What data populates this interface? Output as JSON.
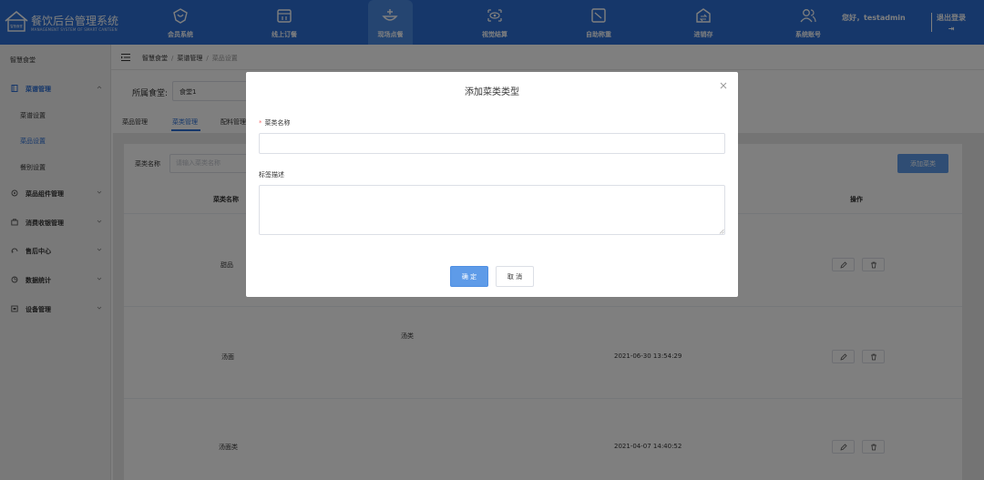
{
  "header": {
    "logo_text": "智慧食堂",
    "app_title": "餐饮后台管理系统",
    "app_subtitle": "MANAGEMENT SYSTEM OF SMART CANTEEN",
    "nav": [
      {
        "label": "会员系统",
        "icon": "heart-shield-icon"
      },
      {
        "label": "线上订餐",
        "icon": "storefront-icon"
      },
      {
        "label": "现场点餐",
        "icon": "dish-icon",
        "active": true
      },
      {
        "label": "视觉结算",
        "icon": "eye-icon"
      },
      {
        "label": "自助称重",
        "icon": "scale-icon"
      },
      {
        "label": "进销存",
        "icon": "inventory-icon"
      },
      {
        "label": "系统账号",
        "icon": "users-icon"
      }
    ],
    "greeting": "您好，testadmin",
    "logout": "退出登录"
  },
  "sidebar": {
    "root": "智慧食堂",
    "groups": [
      {
        "label": "菜谱管理",
        "icon": "book-icon",
        "open": true,
        "items": [
          "菜谱设置",
          "菜品设置",
          "餐别设置"
        ],
        "active_item": "菜品设置"
      },
      {
        "label": "菜品组件管理",
        "icon": "component-icon"
      },
      {
        "label": "消费收银管理",
        "icon": "cashier-icon"
      },
      {
        "label": "售后中心",
        "icon": "service-icon"
      },
      {
        "label": "数据统计",
        "icon": "stats-icon"
      },
      {
        "label": "设备管理",
        "icon": "device-icon"
      }
    ]
  },
  "breadcrumb": {
    "items": [
      "智慧食堂",
      "菜谱管理",
      "菜品设置"
    ]
  },
  "canteen": {
    "label": "所属食堂:",
    "value": "食堂1"
  },
  "tabs": [
    {
      "label": "菜品管理"
    },
    {
      "label": "菜类管理",
      "active": true
    },
    {
      "label": "配料管理"
    }
  ],
  "filter": {
    "label": "菜类名称",
    "placeholder": "请输入菜类名称"
  },
  "add_button": "添加菜类",
  "table": {
    "columns": {
      "name": "菜类名称",
      "actions": "操作"
    },
    "rows": [
      {
        "name": "甜品",
        "description": "",
        "time": ""
      },
      {
        "name": "汤面",
        "description": "汤类",
        "time": "2021-06-30 13:54:29"
      },
      {
        "name": "汤面类",
        "description": "",
        "time": "2021-04-07 14:40:52"
      }
    ]
  },
  "modal": {
    "title": "添加菜类类型",
    "required_mark": "*",
    "name_label": "菜类名称",
    "name_value": "",
    "desc_label": "标签描述",
    "desc_value": "",
    "confirm": "确 定",
    "cancel": "取 消"
  },
  "colors": {
    "primary": "#2c6fd4",
    "button": "#5e9be8",
    "required": "#f56c6c"
  }
}
